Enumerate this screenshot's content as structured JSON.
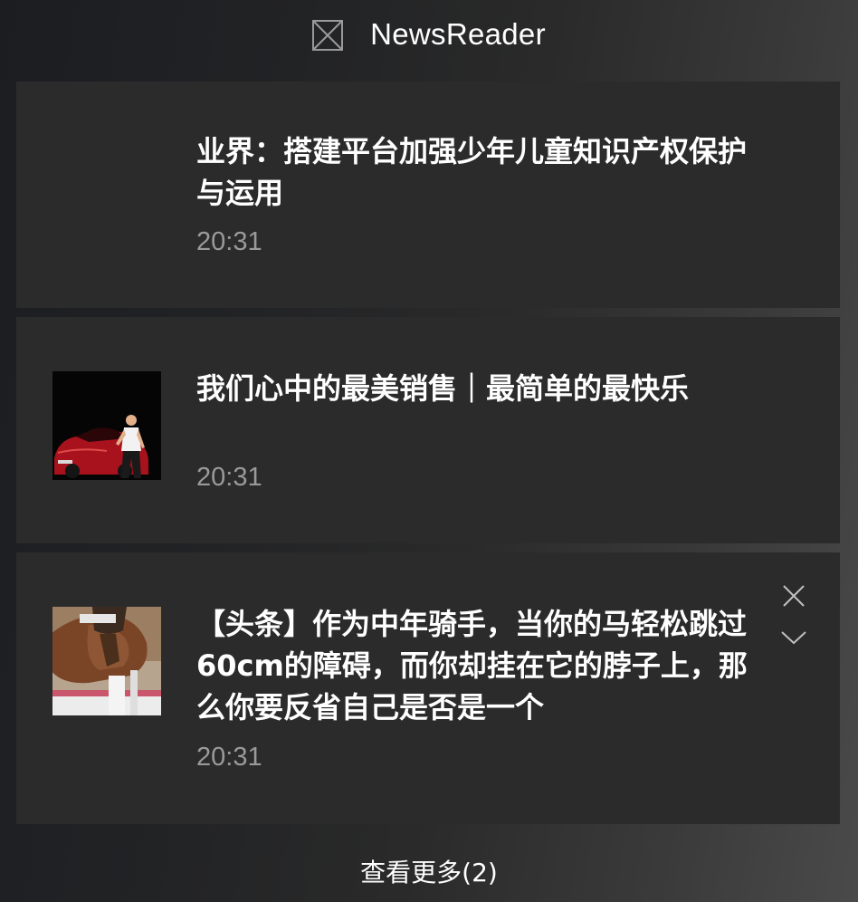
{
  "app": {
    "title": "NewsReader",
    "icon": "broken-image-icon"
  },
  "notifications": [
    {
      "title": "业界：搭建平台加强少年儿童知识产权保护与运用",
      "time": "20:31",
      "has_thumbnail": false
    },
    {
      "title": "我们心中的最美销售｜最简单的最快乐",
      "time": "20:31",
      "has_thumbnail": true,
      "thumbnail": "man-with-red-car-photo"
    },
    {
      "title": "【头条】作为中年骑手，当你的马轻松跳过60cm的障碍，而你却挂在它的脖子上，那么你要反省自己是否是一个",
      "time": "20:31",
      "has_thumbnail": true,
      "thumbnail": "horse-jumping-photo",
      "actions": {
        "dismiss_icon": "close-icon",
        "expand_icon": "chevron-down-icon"
      }
    }
  ],
  "footer": {
    "see_more_label": "查看更多(2)"
  }
}
